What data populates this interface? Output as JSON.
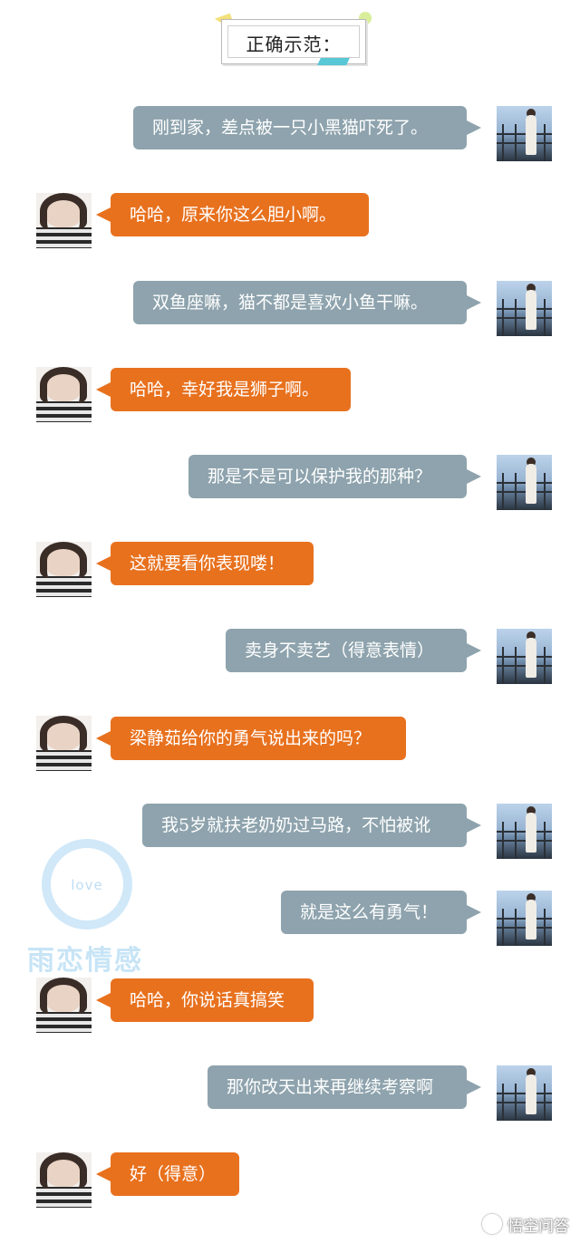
{
  "title": "正确示范：",
  "messages": [
    {
      "side": "right",
      "text": "刚到家，差点被一只小黑猫吓死了。"
    },
    {
      "side": "left",
      "text": "哈哈，原来你这么胆小啊。"
    },
    {
      "side": "right",
      "text": "双鱼座嘛，猫不都是喜欢小鱼干嘛。"
    },
    {
      "side": "left",
      "text": "哈哈，幸好我是狮子啊。"
    },
    {
      "side": "right",
      "text": "那是不是可以保护我的那种？"
    },
    {
      "side": "left",
      "text": "这就要看你表现喽！"
    },
    {
      "side": "right",
      "text": "卖身不卖艺（得意表情）"
    },
    {
      "side": "left",
      "text": "梁静茹给你的勇气说出来的吗？"
    },
    {
      "side": "right",
      "text": "我5岁就扶老奶奶过马路，不怕被讹"
    },
    {
      "side": "right",
      "text": "就是这么有勇气！"
    },
    {
      "side": "left",
      "text": "哈哈，你说话真搞笑"
    },
    {
      "side": "right",
      "text": "那你改天出来再继续考察啊"
    },
    {
      "side": "left",
      "text": "好（得意）"
    }
  ],
  "watermark": {
    "love": "love",
    "text": "雨恋情感"
  },
  "logo": {
    "text": "悟空问答"
  },
  "colors": {
    "sent_bubble": "#8ea3ad",
    "received_bubble": "#e8711e"
  }
}
